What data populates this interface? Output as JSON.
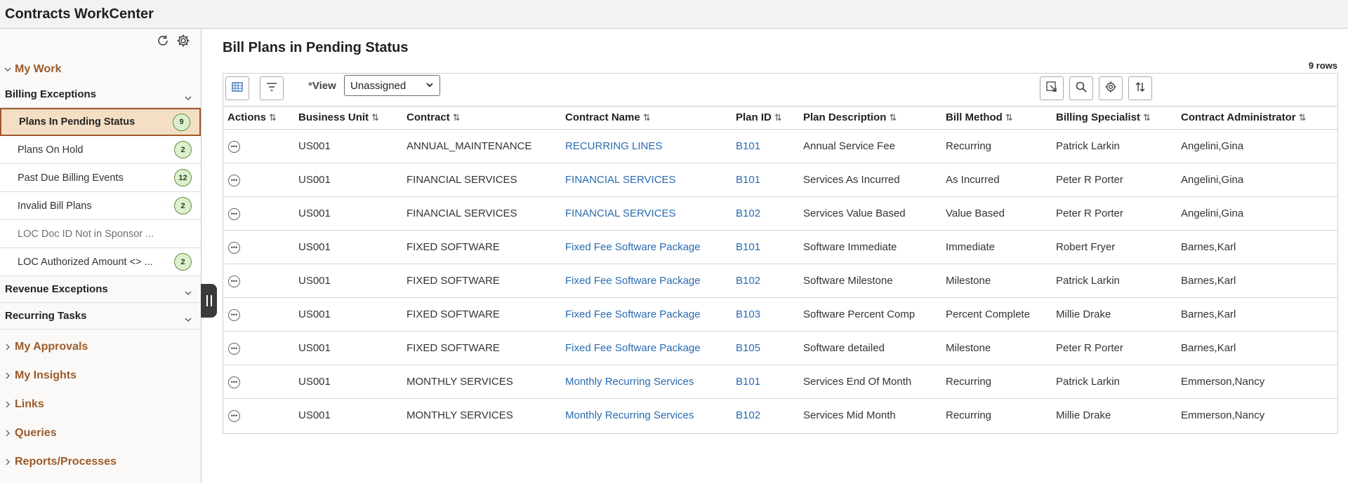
{
  "header": {
    "title": "Contracts WorkCenter"
  },
  "sidebar": {
    "tools": {
      "refresh_icon": "refresh-icon",
      "settings_icon": "gear-icon"
    },
    "my_work": {
      "label": "My Work"
    },
    "billing_exceptions": {
      "label": "Billing Exceptions",
      "items": [
        {
          "label": "Plans In Pending Status",
          "count": "9"
        },
        {
          "label": "Plans On Hold",
          "count": "2"
        },
        {
          "label": "Past Due Billing Events",
          "count": "12"
        },
        {
          "label": "Invalid Bill Plans",
          "count": "2"
        },
        {
          "label": "LOC Doc ID Not in Sponsor ...",
          "count": ""
        },
        {
          "label": "LOC Authorized Amount <> ...",
          "count": "2"
        }
      ]
    },
    "revenue_exceptions": {
      "label": "Revenue Exceptions"
    },
    "recurring_tasks": {
      "label": "Recurring Tasks"
    },
    "sections": [
      {
        "label": "My Approvals"
      },
      {
        "label": "My Insights"
      },
      {
        "label": "Links"
      },
      {
        "label": "Queries"
      },
      {
        "label": "Reports/Processes"
      }
    ]
  },
  "main": {
    "title": "Bill Plans in Pending Status",
    "row_count": "9 rows",
    "view": {
      "required_mark": "*",
      "label": "View",
      "selected": "Unassigned"
    },
    "columns": [
      "Actions",
      "Business Unit",
      "Contract",
      "Contract Name",
      "Plan ID",
      "Plan Description",
      "Bill Method",
      "Billing Specialist",
      "Contract Administrator"
    ],
    "rows": [
      {
        "bu": "US001",
        "contract": "ANNUAL_MAINTENANCE",
        "name": "RECURRING LINES",
        "plan": "B101",
        "desc": "Annual Service Fee",
        "method": "Recurring",
        "specialist": "Patrick Larkin",
        "admin": "Angelini,Gina"
      },
      {
        "bu": "US001",
        "contract": "FINANCIAL SERVICES",
        "name": "FINANCIAL SERVICES",
        "plan": "B101",
        "desc": "Services As Incurred",
        "method": "As Incurred",
        "specialist": "Peter R Porter",
        "admin": "Angelini,Gina"
      },
      {
        "bu": "US001",
        "contract": "FINANCIAL SERVICES",
        "name": "FINANCIAL SERVICES",
        "plan": "B102",
        "desc": "Services Value Based",
        "method": "Value Based",
        "specialist": "Peter R Porter",
        "admin": "Angelini,Gina"
      },
      {
        "bu": "US001",
        "contract": "FIXED SOFTWARE",
        "name": "Fixed Fee Software Package",
        "plan": "B101",
        "desc": "Software Immediate",
        "method": "Immediate",
        "specialist": "Robert Fryer",
        "admin": "Barnes,Karl"
      },
      {
        "bu": "US001",
        "contract": "FIXED SOFTWARE",
        "name": "Fixed Fee Software Package",
        "plan": "B102",
        "desc": "Software Milestone",
        "method": "Milestone",
        "specialist": "Patrick Larkin",
        "admin": "Barnes,Karl"
      },
      {
        "bu": "US001",
        "contract": "FIXED SOFTWARE",
        "name": "Fixed Fee Software Package",
        "plan": "B103",
        "desc": "Software Percent Comp",
        "method": "Percent Complete",
        "specialist": "Millie Drake",
        "admin": "Barnes,Karl"
      },
      {
        "bu": "US001",
        "contract": "FIXED SOFTWARE",
        "name": "Fixed Fee Software Package",
        "plan": "B105",
        "desc": "Software detailed",
        "method": "Milestone",
        "specialist": "Peter R Porter",
        "admin": "Barnes,Karl"
      },
      {
        "bu": "US001",
        "contract": "MONTHLY SERVICES",
        "name": "Monthly Recurring Services",
        "plan": "B101",
        "desc": "Services End Of Month",
        "method": "Recurring",
        "specialist": "Patrick Larkin",
        "admin": "Emmerson,Nancy"
      },
      {
        "bu": "US001",
        "contract": "MONTHLY SERVICES",
        "name": "Monthly Recurring Services",
        "plan": "B102",
        "desc": "Services Mid Month",
        "method": "Recurring",
        "specialist": "Millie Drake",
        "admin": "Emmerson,Nancy"
      }
    ]
  }
}
